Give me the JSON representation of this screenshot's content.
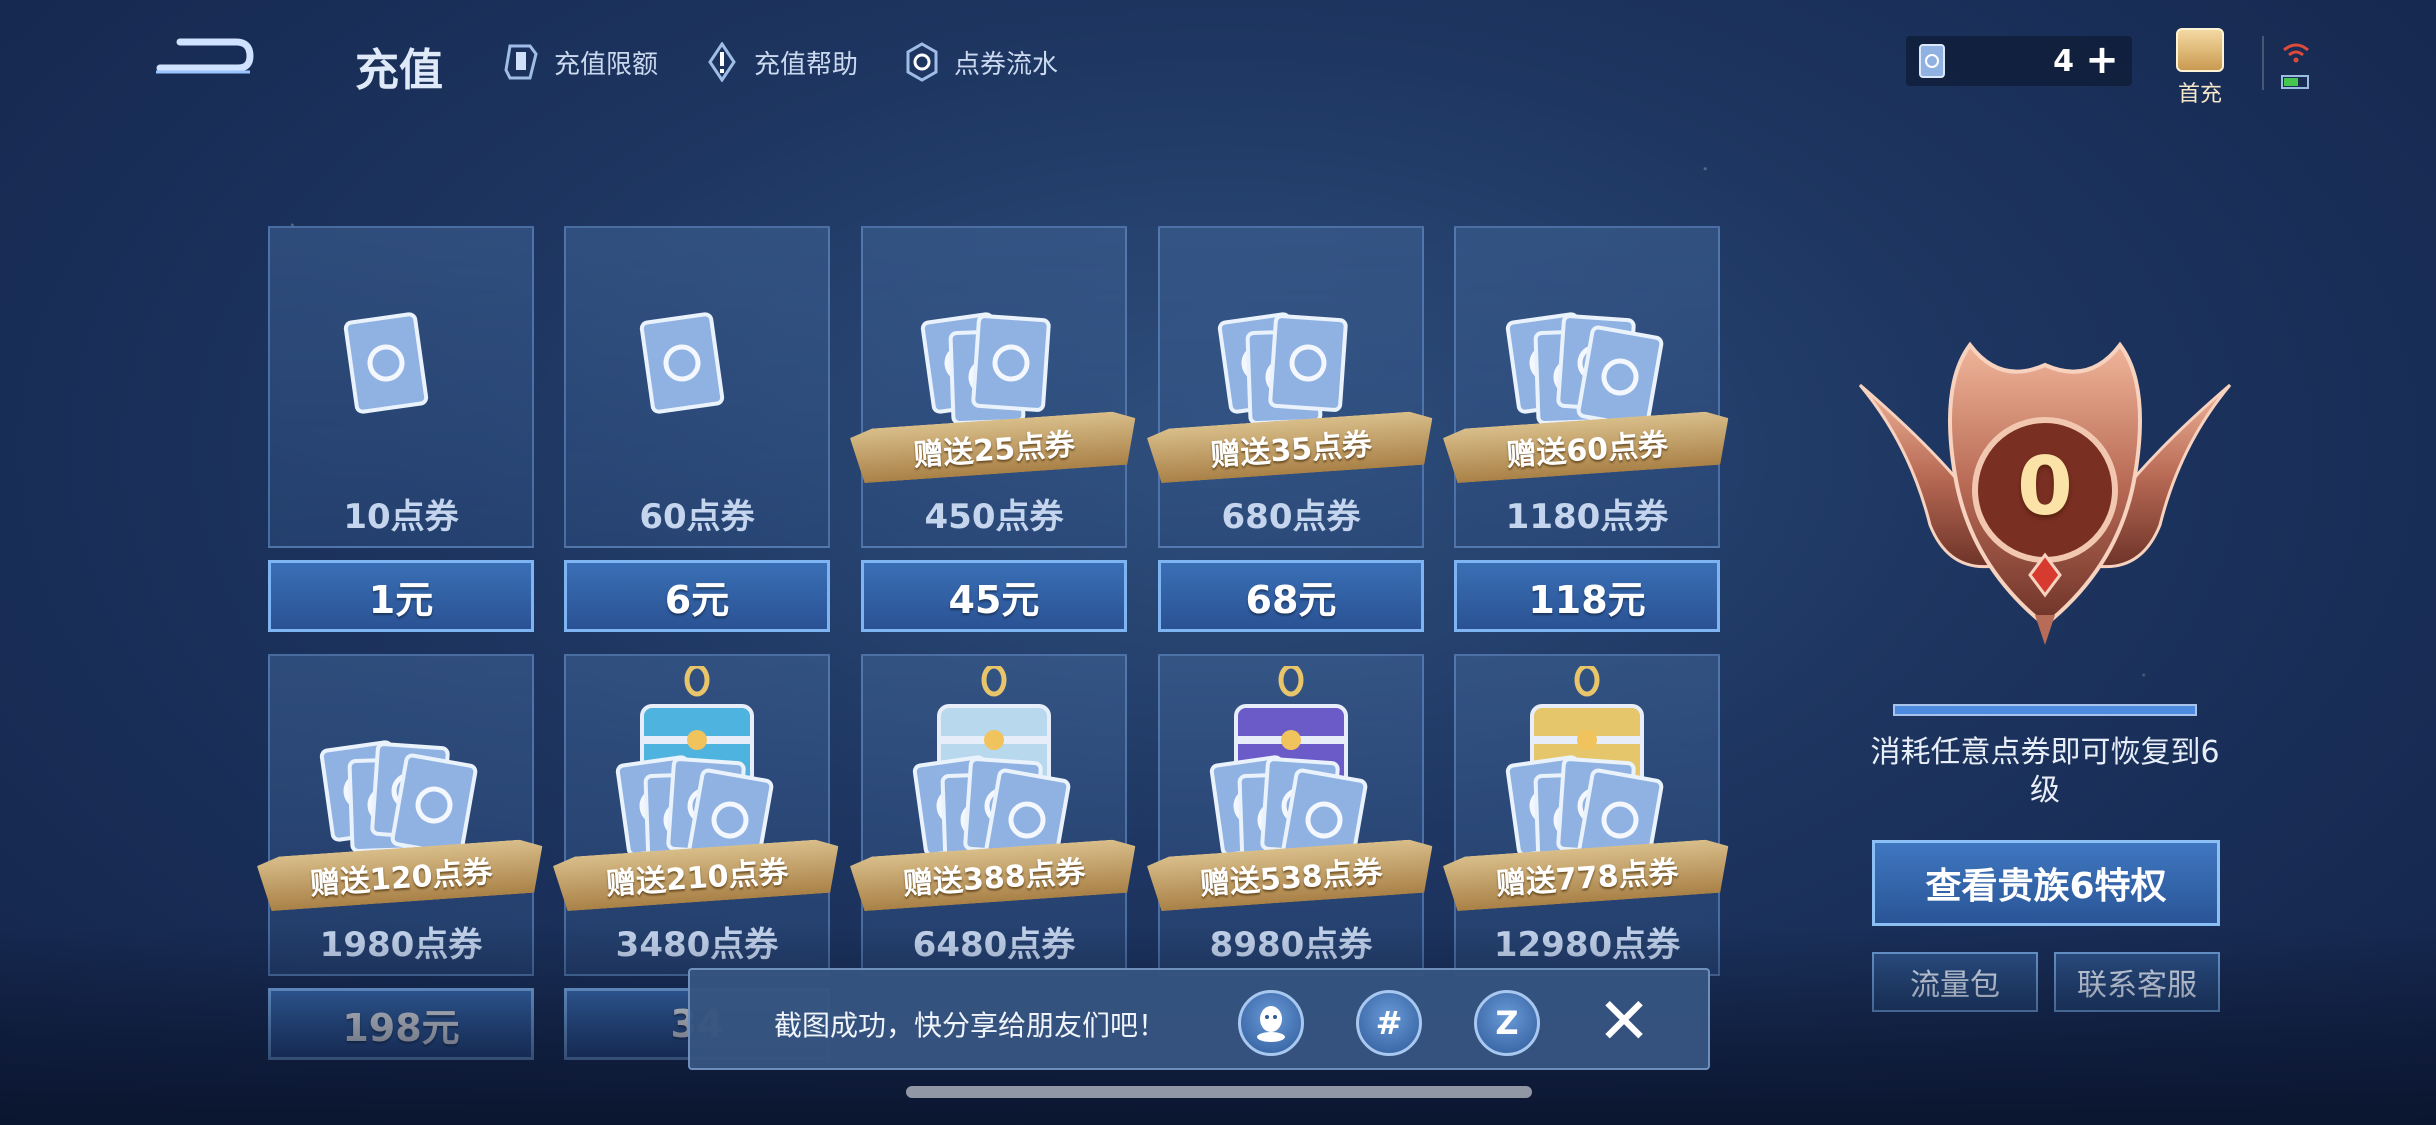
{
  "header": {
    "title": "充值",
    "links": [
      "充值限额",
      "充值帮助",
      "点券流水"
    ],
    "balance": "4",
    "first_charge_label": "首充"
  },
  "packages": [
    {
      "amount": "10点券",
      "price": "1元",
      "bonus": ""
    },
    {
      "amount": "60点券",
      "price": "6元",
      "bonus": ""
    },
    {
      "amount": "450点券",
      "price": "45元",
      "bonus": "赠送25点券"
    },
    {
      "amount": "680点券",
      "price": "68元",
      "bonus": "赠送35点券"
    },
    {
      "amount": "1180点券",
      "price": "118元",
      "bonus": "赠送60点券"
    },
    {
      "amount": "1980点券",
      "price": "198元",
      "bonus": "赠送120点券"
    },
    {
      "amount": "3480点券",
      "price": "34",
      "bonus": "赠送210点券"
    },
    {
      "amount": "6480点券",
      "price": "",
      "bonus": "赠送388点券"
    },
    {
      "amount": "8980点券",
      "price": "",
      "bonus": "赠送538点券"
    },
    {
      "amount": "12980点券",
      "price": "",
      "bonus": "赠送778点券"
    }
  ],
  "vip": {
    "level": "0",
    "description": "消耗任意点券即可恢复到6级",
    "privilege_button": "查看贵族6特权",
    "data_pack_button": "流量包",
    "service_button": "联系客服"
  },
  "toast": {
    "message": "截图成功，快分享给朋友们吧！",
    "share_icons": [
      "qq-icon",
      "wechat-moments-icon",
      "qzone-icon"
    ]
  },
  "colors": {
    "accent": "#3a6fb5",
    "bonus_ribbon": "#c9a56a",
    "background": "#1d3560"
  }
}
